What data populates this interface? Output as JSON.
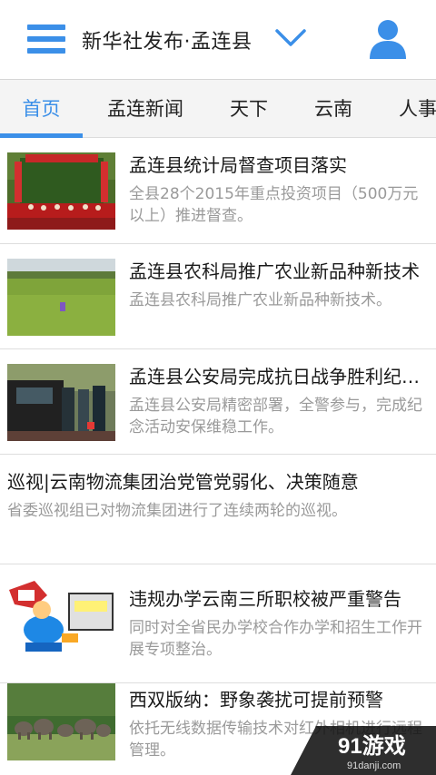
{
  "header": {
    "title": "新华社发布·孟连县",
    "menu_icon": "hamburger-menu-icon",
    "dropdown_icon": "chevron-down-icon",
    "user_icon": "user-profile-icon",
    "accent": "#3b8fe8"
  },
  "tabs": [
    {
      "label": "首页",
      "active": true
    },
    {
      "label": "孟连新闻",
      "active": false
    },
    {
      "label": "天下",
      "active": false
    },
    {
      "label": "云南",
      "active": false
    },
    {
      "label": "人事",
      "active": false
    }
  ],
  "news": [
    {
      "title": "孟连县统计局督查项目落实",
      "desc": "全县28个2015年重点投资项目（500万元以上）推进督查。",
      "thumb": "event-stage-photo"
    },
    {
      "title": "孟连县农科局推广农业新品种新技术",
      "desc": "孟连县农科局推广农业新品种新技术。",
      "thumb": "rice-field-photo"
    },
    {
      "title": "孟连县公安局完成抗日战争胜利纪念活动安保维稳工作",
      "desc": "孟连县公安局精密部署，全警参与，完成纪念活动安保维稳工作。",
      "thumb": "police-car-photo"
    },
    {
      "title": "巡视|云南物流集团治党管党弱化、决策随意",
      "desc": "省委巡视组已对物流集团进行了连续两轮的巡视。",
      "thumb": null
    },
    {
      "title": "违规办学云南三所职校被严重警告",
      "desc": "同时对全省民办学校合作办学和招生工作开展专项整治。",
      "thumb": "cartoon-illustration"
    },
    {
      "title": "西双版纳：野象袭扰可提前预警",
      "desc": "依托无线数据传输技术对红外相机进行远程管理。",
      "thumb": "elephants-photo"
    }
  ],
  "watermark": {
    "brand": "91游戏",
    "url": "91danji.com"
  }
}
